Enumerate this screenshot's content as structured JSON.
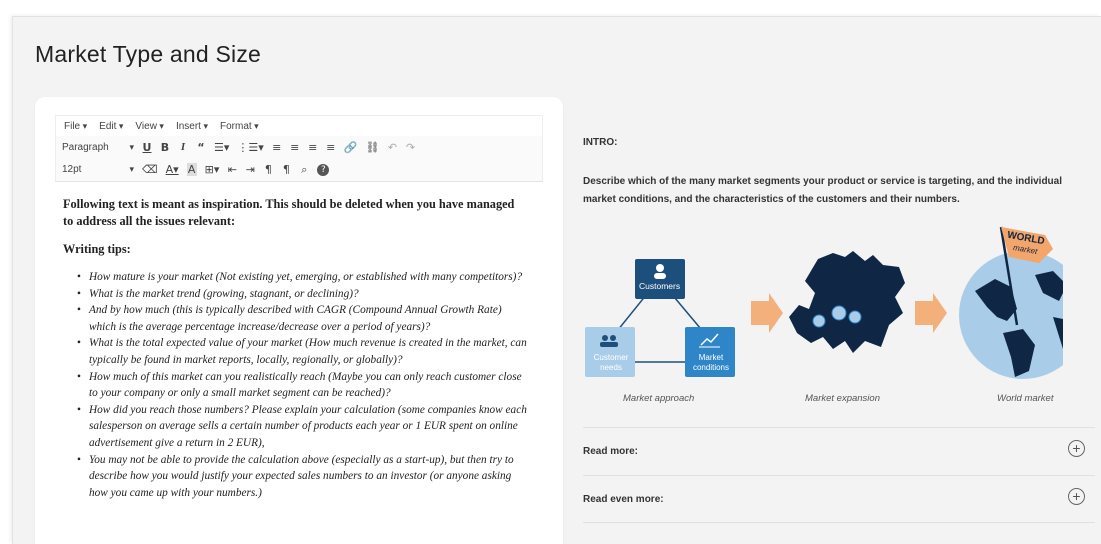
{
  "page": {
    "title": "Market Type and Size"
  },
  "editor": {
    "menu": [
      "File",
      "Edit",
      "View",
      "Insert",
      "Format"
    ],
    "block_format": "Paragraph",
    "font_size": "12pt",
    "lead": "Following text is meant as inspiration. This should be deleted when you have managed to address all the issues relevant:",
    "tips_heading": "Writing tips:",
    "tips": [
      "How mature is your market (Not existing yet, emerging, or established with many competitors)?",
      "What is the market trend (growing, stagnant, or declining)?",
      "And by how much (this is typically described with CAGR (Compound Annual Growth Rate) which is the average percentage increase/decrease over a period of years)?",
      "What is the total expected value of your market (How much revenue is created in the market, can typically be found in market reports, locally, regionally, or globally)?",
      "How much of this market can you realistically reach (Maybe you can only reach customer close to your company or only a small market segment can be reached)?",
      "How did you reach those numbers? Please explain your calculation (some companies know each salesperson on average sells a certain number of products each year or 1 EUR spent on online advertisement give a return in 2 EUR),",
      "You may not be able to provide the calculation above (especially as a start-up), but then try to describe how you would justify your expected sales numbers to an investor (or anyone asking how you came up with your numbers.)"
    ]
  },
  "intro": {
    "heading": "INTRO:",
    "text": "Describe which of the many market segments your product or service is targeting, and the individual market conditions, and the characteristics of the customers and their numbers.",
    "graphic": {
      "node_customers": "Customers",
      "node_needs": "Customer needs",
      "node_conditions": "Market conditions",
      "flag_line1": "WORLD",
      "flag_line2": "market",
      "caption_approach": "Market approach",
      "caption_expansion": "Market expansion",
      "caption_world": "World market",
      "colors": {
        "dark_blue": "#1d4f7c",
        "light_blue": "#a9cde8",
        "mid_blue": "#2e86c9",
        "arrow": "#f4b07a",
        "map": "#0f2744",
        "flag": "#f3a56a"
      }
    }
  },
  "accordion": [
    {
      "label": "Read more:"
    },
    {
      "label": "Read even more:"
    }
  ]
}
